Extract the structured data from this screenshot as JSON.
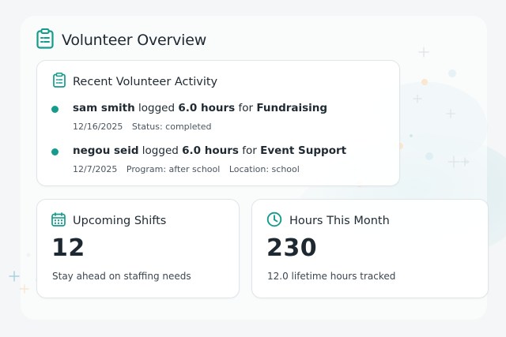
{
  "page": {
    "title": "Volunteer Overview",
    "icon": "clipboard-icon",
    "accent": "#159b8c"
  },
  "activity": {
    "title": "Recent Volunteer Activity",
    "icon": "clipboard-icon",
    "items": [
      {
        "name": "sam smith",
        "verb": "logged",
        "hours": "6.0 hours",
        "prep": "for",
        "category": "Fundraising",
        "date": "12/16/2025",
        "meta1": "Status: completed",
        "meta2": ""
      },
      {
        "name": "negou seid",
        "verb": "logged",
        "hours": "6.0 hours",
        "prep": "for",
        "category": "Event Support",
        "date": "12/7/2025",
        "meta1": "Program: after school",
        "meta2": "Location: school"
      }
    ]
  },
  "shifts": {
    "title": "Upcoming Shifts",
    "icon": "calendar-icon",
    "value": "12",
    "subtitle": "Stay ahead on staffing needs"
  },
  "hours": {
    "title": "Hours This Month",
    "icon": "clock-icon",
    "value": "230",
    "subtitle": "12.0 lifetime hours tracked"
  }
}
